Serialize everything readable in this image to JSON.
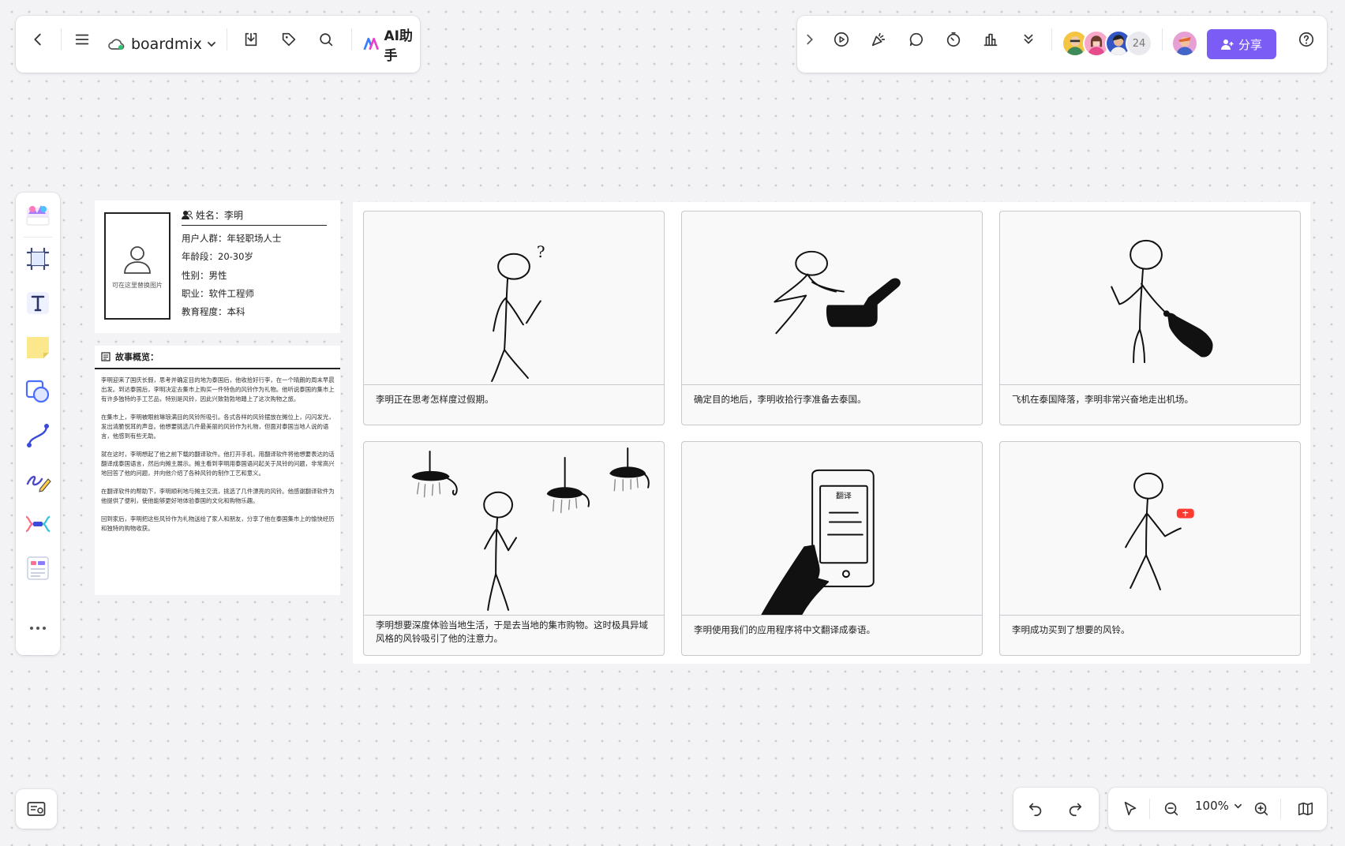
{
  "app": {
    "name": "boardmix",
    "ai_label": "AI助手",
    "share_label": "分享",
    "collaborator_count": "24",
    "accent_color": "#7b5cf5"
  },
  "toolbar_left_icons": [
    "back-icon",
    "menu-icon",
    "cloud-icon",
    "download-icon",
    "tag-icon",
    "search-icon",
    "ai-logo-icon"
  ],
  "toolbar_right_icons": [
    "expand-icon",
    "play-icon",
    "celebrate-icon",
    "comment-icon",
    "timer-icon",
    "vote-icon",
    "more-icon",
    "help-icon"
  ],
  "left_tools": [
    "template-icon",
    "frame-icon",
    "text-icon",
    "sticky-note-icon",
    "shape-icon",
    "connector-icon",
    "pen-icon",
    "mindmap-icon",
    "card-icon",
    "more-dots-icon"
  ],
  "zoom": {
    "value": "100%"
  },
  "persona": {
    "photo_caption": "可在这里替换图片",
    "name": "姓名：李明",
    "group": "用户人群：年轻职场人士",
    "age": "年龄段：20-30岁",
    "gender": "性别：男性",
    "job": "职业：软件工程师",
    "education": "教育程度：本科"
  },
  "story": {
    "title": "故事概览：",
    "paragraphs": [
      "李明迎来了国庆长假，思考并确定目的地为泰国后，他收拾好行李，在一个晴朗的周末早晨出发。到达泰国后，李明决定去集市上购买一件特色的风铃作为礼物。他听说泰国的集市上有许多独特的手工艺品，特别是风铃，因此兴致勃勃地踏上了这次购物之旅。",
      "在集市上，李明被眼前琳琅满目的风铃所吸引。各式各样的风铃摆放在摊位上，闪闪发光，发出清脆悦耳的声音。他想要挑选几件最美丽的风铃作为礼物，但面对泰国当地人说的语言，他感到有些无助。",
      "就在这时，李明想起了他之前下载的翻译软件。他打开手机，用翻译软件将他想要表达的话翻译成泰国语言，然后向摊主展示。摊主看到李明用泰国语问起关于风铃的问题，非常高兴地回答了他的问题，并向他介绍了各种风铃的制作工艺和意义。",
      "在翻译软件的帮助下，李明顺利地与摊主交流，挑选了几件漂亮的风铃。他感谢翻译软件为他提供了便利，使他能够更好地体验泰国的文化和购物乐趣。",
      "回到家后，李明把这些风铃作为礼物送给了家人和朋友，分享了他在泰国集市上的愉快经历和独特的购物收获。"
    ]
  },
  "frames": [
    {
      "caption": "李明正在思考怎样度过假期。"
    },
    {
      "caption": "确定目的地后，李明收拾行李准备去泰国。"
    },
    {
      "caption": "飞机在泰国降落，李明非常兴奋地走出机场。"
    },
    {
      "caption": "李明想要深度体验当地生活，于是去当地的集市购物。这时极具异域风格的风铃吸引了他的注意力。"
    },
    {
      "caption": "李明使用我们的应用程序将中文翻译成泰语。"
    },
    {
      "caption": "李明成功买到了想要的风铃。"
    }
  ],
  "frame_art": {
    "question_mark": "?",
    "phone_label": "翻译"
  }
}
